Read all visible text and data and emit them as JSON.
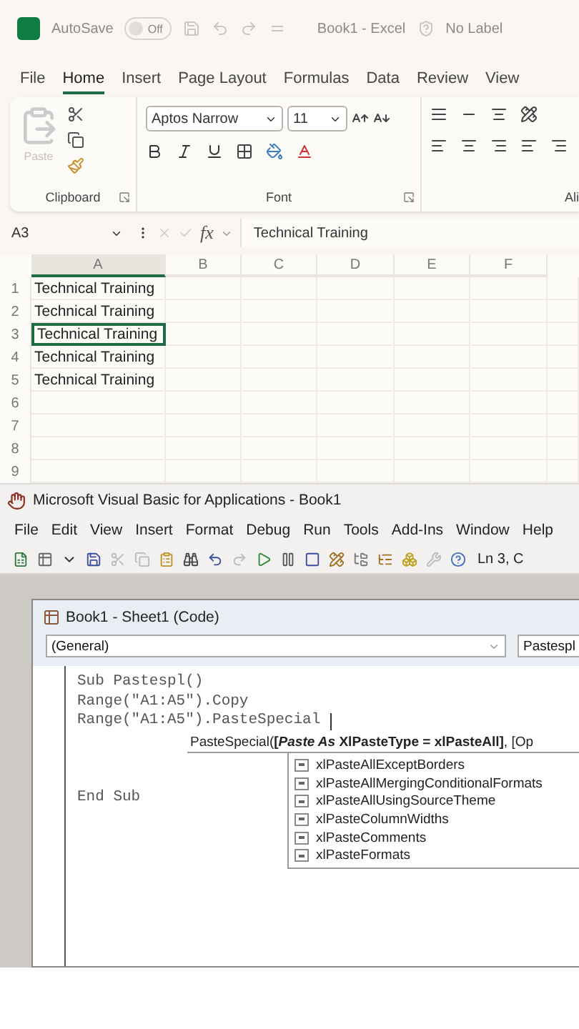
{
  "excel_title_bar": {
    "autosave_label": "AutoSave",
    "autosave_toggle": {
      "label": "Off",
      "on": false
    },
    "document_title": "Book1 - Excel",
    "sensitivity_label": "No Label"
  },
  "ribbon_tabs": [
    {
      "label": "File",
      "selected": false
    },
    {
      "label": "Home",
      "selected": true
    },
    {
      "label": "Insert",
      "selected": false
    },
    {
      "label": "Page Layout",
      "selected": false
    },
    {
      "label": "Formulas",
      "selected": false
    },
    {
      "label": "Data",
      "selected": false
    },
    {
      "label": "Review",
      "selected": false
    },
    {
      "label": "View",
      "selected": false
    }
  ],
  "ribbon": {
    "clipboard": {
      "paste_label": "Paste",
      "group_label": "Clipboard"
    },
    "font": {
      "font_name": "Aptos Narrow",
      "font_size": "11",
      "group_label": "Font"
    },
    "alignment": {
      "group_label": "Ali"
    }
  },
  "formula_bar": {
    "name_box": "A3",
    "fx_label": "fx",
    "value": "Technical Training"
  },
  "sheet": {
    "columns": [
      {
        "label": "A",
        "selected": true
      },
      {
        "label": "B",
        "selected": false
      },
      {
        "label": "C",
        "selected": false
      },
      {
        "label": "D",
        "selected": false
      },
      {
        "label": "E",
        "selected": false
      },
      {
        "label": "F",
        "selected": false
      }
    ],
    "rows": [
      {
        "number": "1",
        "cell_a": {
          "value": "Technical Training",
          "selected": false
        }
      },
      {
        "number": "2",
        "cell_a": {
          "value": "Technical Training",
          "selected": false
        }
      },
      {
        "number": "3",
        "cell_a": {
          "value": "Technical Training",
          "selected": true
        }
      },
      {
        "number": "4",
        "cell_a": {
          "value": "Technical Training",
          "selected": false
        }
      },
      {
        "number": "5",
        "cell_a": {
          "value": "Technical Training",
          "selected": false
        }
      },
      {
        "number": "6"
      },
      {
        "number": "7"
      },
      {
        "number": "8"
      },
      {
        "number": "9"
      }
    ]
  },
  "vba_window": {
    "title": "Microsoft Visual Basic for Applications - Book1",
    "menu": [
      "File",
      "Edit",
      "View",
      "Insert",
      "Format",
      "Debug",
      "Run",
      "Tools",
      "Add-Ins",
      "Window",
      "Help"
    ],
    "status": "Ln 3, C"
  },
  "code_window": {
    "title": "Book1 - Sheet1 (Code)",
    "object_dropdown": "(General)",
    "procedure_dropdown": "Pastespl",
    "code_lines": [
      "Sub Pastespl()",
      "Range(\"A1:A5\").Copy",
      "Range(\"A1:A5\").PasteSpecial"
    ],
    "parameter_tip": "PasteSpecial(**[*Paste As* XlPasteType = xlPasteAll]**, [Op",
    "code_after": [
      "End Sub"
    ],
    "completion_list": [
      "xlPasteAllExceptBorders",
      "xlPasteAllMergingConditionalFormats",
      "xlPasteAllUsingSourceTheme",
      "xlPasteColumnWidths",
      "xlPasteComments",
      "xlPasteFormats"
    ]
  }
}
